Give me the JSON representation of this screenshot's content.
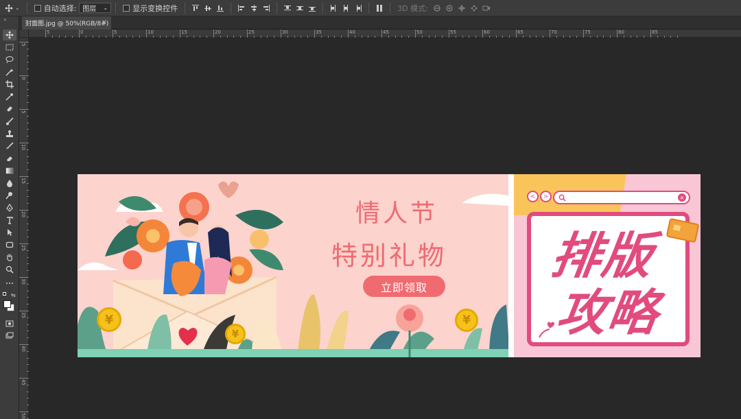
{
  "options_bar": {
    "auto_select_label": "自动选择:",
    "auto_select_value": "图层",
    "show_transform_label": "显示变换控件",
    "mode_3d_label": "3D 模式:"
  },
  "document_tab": {
    "title": "封面图.jpg @ 50%(RGB/8#)",
    "close": "×"
  },
  "rulers": {
    "h_labels": [
      "5",
      "0",
      "5",
      "10",
      "15",
      "20",
      "25",
      "30",
      "35",
      "40",
      "45",
      "50",
      "55",
      "60",
      "65",
      "70",
      "75",
      "80",
      "85"
    ],
    "v_labels": [
      "5",
      "0",
      "5",
      "10",
      "15",
      "20",
      "25",
      "30",
      "35",
      "40",
      "45",
      "50"
    ]
  },
  "tools": {
    "icons": [
      "move-tool-icon",
      "marquee-tool-icon",
      "lasso-tool-icon",
      "magic-wand-icon",
      "crop-tool-icon",
      "eyedropper-icon",
      "healing-brush-icon",
      "brush-tool-icon",
      "clone-stamp-icon",
      "history-brush-icon",
      "eraser-icon",
      "gradient-tool-icon",
      "blur-tool-icon",
      "dodge-tool-icon",
      "pen-tool-icon",
      "type-tool-icon",
      "path-select-icon",
      "shape-tool-icon",
      "hand-tool-icon",
      "zoom-tool-icon",
      "more-tools-icon"
    ]
  },
  "canvas": {
    "title_line1": "情人节",
    "title_line2": "特别礼物",
    "cta_label": "立即领取",
    "headline1": "排版",
    "headline2": "攻略",
    "coin_symbol": "¥",
    "colors": {
      "left_bg": "#fcd3cd",
      "right_bg": "#f9c6d6",
      "accent_pink": "#e14b7d",
      "title_red": "#ef6b72"
    }
  }
}
